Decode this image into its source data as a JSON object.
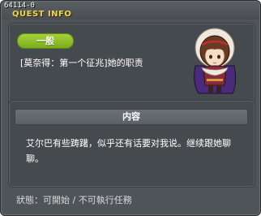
{
  "window": {
    "quest_id": "64114-0",
    "title": "QUEST INFO"
  },
  "quest": {
    "category": "一般",
    "name": "[莫奈得：第一个征兆]她的职责",
    "npc_portrait_icon": "npc-portrait-icon"
  },
  "content": {
    "header": "内容",
    "body": "艾尔巴有些踌躇，似乎还有话要对我说。继续跟她聊聊。"
  },
  "status": {
    "text": "狀態：可開始 / 不可執行任務"
  },
  "colors": {
    "title": "#f3d44a",
    "category_tag": "#8fc028",
    "background": "#4f5459"
  }
}
